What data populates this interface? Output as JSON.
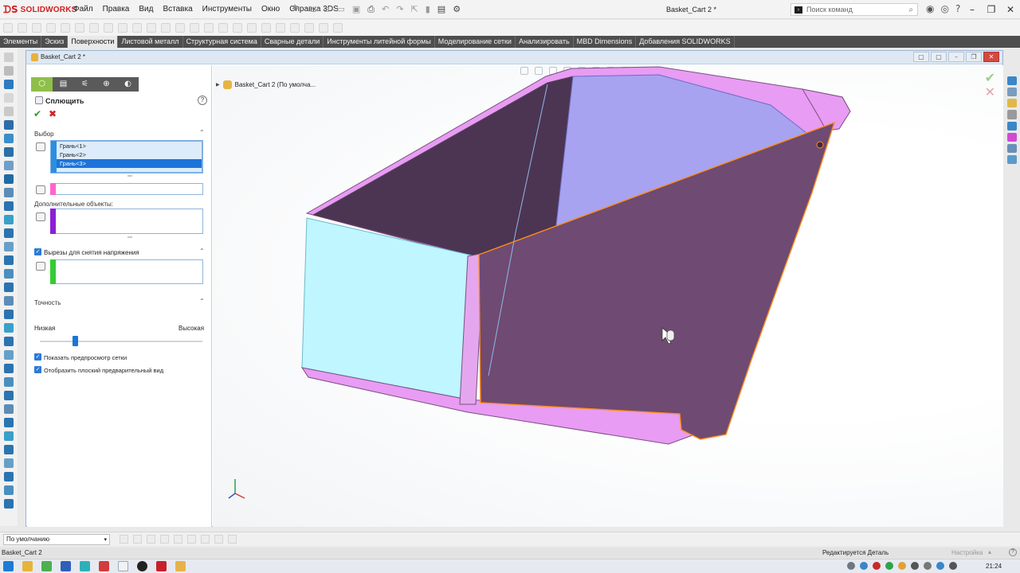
{
  "app": {
    "name": "SOLIDWORKS",
    "menu": [
      "Файл",
      "Правка",
      "Вид",
      "Вставка",
      "Инструменты",
      "Окно",
      "Справка 3DS"
    ],
    "window_title": "Basket_Cart 2 *",
    "search_placeholder": "Поиск команд"
  },
  "tabs": [
    {
      "label": "Элементы"
    },
    {
      "label": "Эскиз"
    },
    {
      "label": "Поверхности",
      "active": true
    },
    {
      "label": "Листовой металл"
    },
    {
      "label": "Структурная система"
    },
    {
      "label": "Сварные детали"
    },
    {
      "label": "Инструменты литейной формы"
    },
    {
      "label": "Моделирование сетки"
    },
    {
      "label": "Анализировать"
    },
    {
      "label": "MBD Dimensions"
    },
    {
      "label": "Добавления SOLIDWORKS"
    }
  ],
  "document": {
    "title": "Basket_Cart 2 *",
    "tree_label": "Basket_Cart 2  (По умолча..."
  },
  "property_manager": {
    "title": "Сплющить",
    "selection_group": "Выбор",
    "faces": [
      "Грань<1>",
      "Грань<2>",
      "Грань<3>"
    ],
    "selected_face_index": 2,
    "extra_objects_label": "Дополнительные объекты:",
    "relief_label": "Вырезы для снятия напряжения",
    "relief_checked": true,
    "accuracy_group": "Точность",
    "accuracy_low": "Низкая",
    "accuracy_high": "Высокая",
    "accuracy_level": 0.2,
    "mesh_preview_label": "Показать предпросмотр сетки",
    "mesh_preview_checked": true,
    "flat_preview_label": "Отобразить плоский предварительный вид",
    "flat_preview_checked": true
  },
  "colors": {
    "swatch_faces": "#2b8fe0",
    "swatch_pink": "#ff66cc",
    "swatch_purple": "#8b1fd6",
    "swatch_green": "#33cc33",
    "model_flat": "#6f4a72",
    "model_pink": "#e89cf3",
    "model_cyan": "#bff6ff",
    "model_lavender": "#a7a3f1",
    "edge_orange": "#ff8c1a"
  },
  "bottom": {
    "configuration": "По умолчанию"
  },
  "status": {
    "file": "Basket_Cart 2",
    "mode": "Редактируется Деталь",
    "settings": "Настройка"
  },
  "taskbar": {
    "time": "21:24"
  }
}
